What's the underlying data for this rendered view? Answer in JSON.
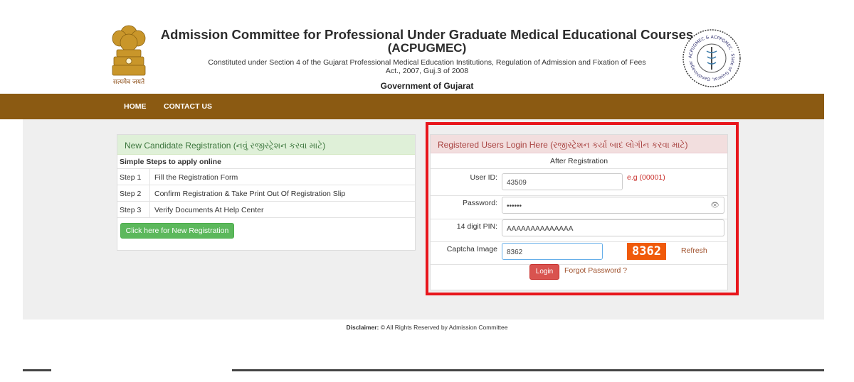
{
  "header": {
    "title_line1": "Admission Committee for Professional Under Graduate Medical Educational Courses",
    "title_line2": "(ACPUGMEC)",
    "subtitle_line1": "Constituted under Section 4 of the Gujarat Professional Medical Education Institutions, Regulation of Admission and Fixation of Fees",
    "subtitle_line2": "Act., 2007, Guj.3 of 2008",
    "government": "Government of Gujarat",
    "emblem_icon": "state-emblem-icon",
    "emblem_motto": "सत्यमेव जयते",
    "seal_icon": "acpugmec-seal-icon",
    "seal_text": "ACPUGMEC & ACPPGMEC · State of Gujarat, Gandhinagar"
  },
  "nav": {
    "home": "HOME",
    "contact": "CONTACT US"
  },
  "new_registration": {
    "heading": "New Candidate Registration (નવું રજીસ્ટ્રેશન કરવા માટે)",
    "steps_title": "Simple Steps to apply online",
    "steps": [
      {
        "num": "Step 1",
        "text": "Fill the Registration Form"
      },
      {
        "num": "Step 2",
        "text": "Confirm Registration & Take Print Out Of Registration Slip"
      },
      {
        "num": "Step 3",
        "text": "Verify Documents At Help Center"
      }
    ],
    "button_label": "Click here for New Registration"
  },
  "login": {
    "heading": "Registered Users Login Here (રજીસ્ટ્રેશન કર્યા બાદ લોગીન કરવા માટે)",
    "subheading": "After Registration",
    "userid_label": "User ID:",
    "userid_value": "43509",
    "userid_example": "e.g (00001)",
    "password_label": "Password:",
    "password_value": "••••••",
    "password_icon": "eye-icon",
    "pin_label": "14 digit PIN:",
    "pin_value": "AAAAAAAAAAAAAA",
    "captcha_label": "Captcha Image",
    "captcha_input_value": "8362",
    "captcha_image_text": "8362",
    "refresh_label": "Refresh",
    "login_button": "Login",
    "forgot_label": "Forgot Password ?",
    "highlight_color": "#e8161c"
  },
  "footer": {
    "disclaimer_label": "Disclaimer:",
    "disclaimer_text": "© All Rights Reserved by Admission Committee"
  },
  "colors": {
    "navbar": "#8b5a12",
    "success_panel": "#dff0d8",
    "danger_panel": "#f2dede",
    "button_green": "#5cb85c",
    "button_red": "#d9534f",
    "captcha_bg": "#f05a0a"
  }
}
